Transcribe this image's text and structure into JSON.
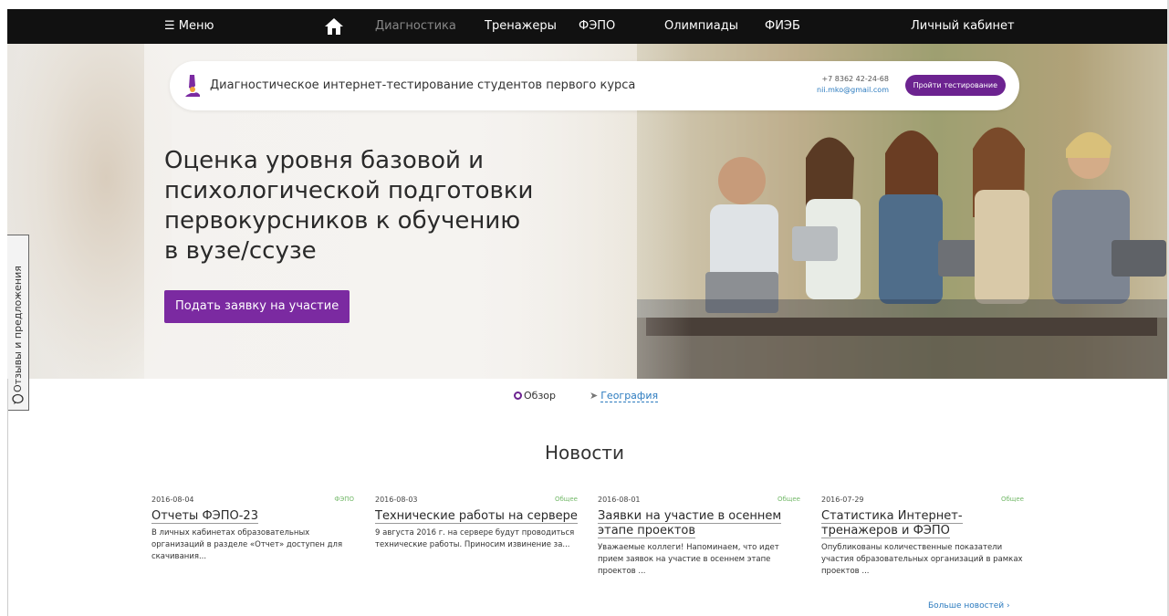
{
  "nav": {
    "menu": "☰ Меню",
    "diagnostics": "Диагностика",
    "trainers": "Тренажеры",
    "fepo": "ФЭПО",
    "olympiads": "Олимпиады",
    "fieb": "ФИЭБ",
    "cabinet": "Личный кабинет"
  },
  "banner": {
    "title": "Диагностическое интернет-тестирование студентов первого курса",
    "phone": "+7 8362 42-24-68",
    "email": "nii.mko@gmail.com",
    "test_button": "Пройти тестирование"
  },
  "hero": {
    "headline_1": "Оценка уровня базовой и",
    "headline_2": "психологической подготовки",
    "headline_3": "первокурсников к обучению",
    "headline_4": "в вузе/ссузе",
    "apply_button": "Подать заявку на участие"
  },
  "feedback": {
    "label": "Отзывы и предложения"
  },
  "subnav": {
    "overview": "Обзор",
    "geography": "География"
  },
  "news": {
    "title": "Новости",
    "items": [
      {
        "date": "2016-08-04",
        "category": "ФЭПО",
        "headline": "Отчеты ФЭПО-23",
        "text": "В личных кабинетах образовательных организаций в разделе «Отчет» доступен для скачивания..."
      },
      {
        "date": "2016-08-03",
        "category": "Общее",
        "headline": "Технические работы на сервере",
        "text": "9 августа 2016 г. на сервере будут проводиться технические работы. Приносим извинение за..."
      },
      {
        "date": "2016-08-01",
        "category": "Общее",
        "headline": "Заявки на участие в осеннем этапе проектов",
        "text": "Уважаемые коллеги! Напоминаем, что идет прием заявок на участие в осеннем этапе проектов ..."
      },
      {
        "date": "2016-07-29",
        "category": "Общее",
        "headline": "Статистика Интернет-тренажеров и ФЭПО",
        "text": "Опубликованы количественные показатели участия образовательных организаций в рамках проектов ..."
      }
    ],
    "more": "Больше новостей ›"
  },
  "colors": {
    "accent": "#7b2aa1",
    "link": "#2c7bbf",
    "category": "#74b96a",
    "nav_bg": "#111111"
  },
  "icons": {
    "home": "home-icon",
    "logo": "microscope-icon",
    "feedback": "chat-bubble-icon",
    "geography": "location-arrow-icon"
  }
}
